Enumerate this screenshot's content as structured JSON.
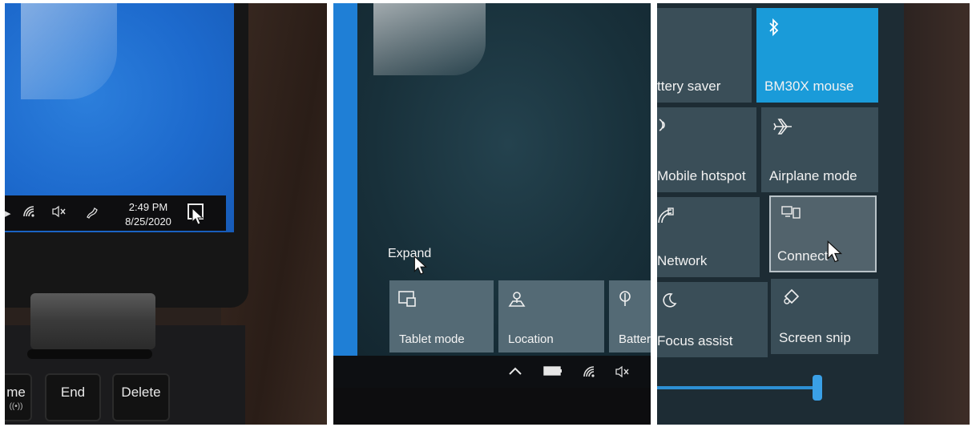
{
  "panel1": {
    "taskbar": {
      "time": "2:49 PM",
      "date": "8/25/2020",
      "icons": [
        "wifi-icon",
        "volume-muted-icon",
        "pen-icon",
        "action-center-icon"
      ]
    },
    "keyboard": {
      "keys": [
        {
          "label": "me",
          "sub": "((•))"
        },
        {
          "label": "End"
        },
        {
          "label": "Delete"
        }
      ]
    }
  },
  "panel2": {
    "expand_label": "Expand",
    "tiles": [
      {
        "label": "Tablet mode",
        "icon": "tablet-mode-icon"
      },
      {
        "label": "Location",
        "icon": "location-icon"
      },
      {
        "label": "Battery",
        "icon": "battery-saver-icon"
      }
    ],
    "tray_icons": [
      "chevron-up-icon",
      "battery-icon",
      "wifi-icon",
      "volume-muted-icon"
    ]
  },
  "panel3": {
    "tiles": [
      {
        "label": "ttery saver",
        "icon": "battery-saver-icon"
      },
      {
        "label": "BM30X mouse",
        "icon": "bluetooth-icon",
        "active": true
      },
      {
        "label": "Mobile hotspot",
        "icon": "mobile-hotspot-icon"
      },
      {
        "label": "Airplane mode",
        "icon": "airplane-icon"
      },
      {
        "label": "Network",
        "icon": "network-icon"
      },
      {
        "label": "Connect",
        "icon": "connect-icon"
      },
      {
        "label": "Focus assist",
        "icon": "moon-icon"
      },
      {
        "label": "Screen snip",
        "icon": "screen-snip-icon"
      }
    ],
    "accent_color": "#1a9bd9"
  }
}
